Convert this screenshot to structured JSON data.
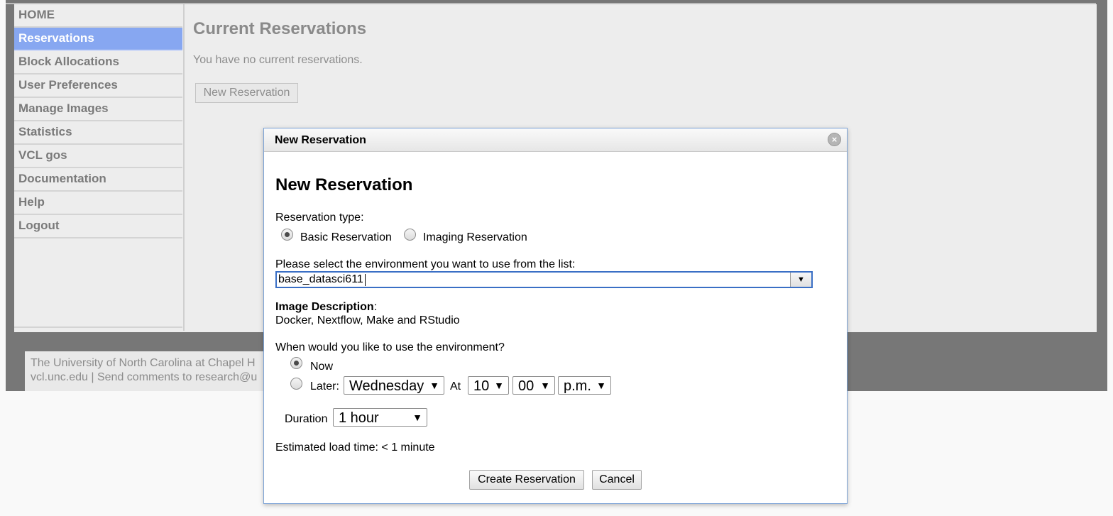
{
  "sidebar": {
    "items": [
      {
        "label": "HOME",
        "active": false
      },
      {
        "label": "Reservations",
        "active": true
      },
      {
        "label": "Block Allocations",
        "active": false
      },
      {
        "label": "User Preferences",
        "active": false
      },
      {
        "label": "Manage Images",
        "active": false
      },
      {
        "label": "Statistics",
        "active": false
      },
      {
        "label": "VCL gos",
        "active": false
      },
      {
        "label": "Documentation",
        "active": false
      },
      {
        "label": "Help",
        "active": false
      },
      {
        "label": "Logout",
        "active": false
      }
    ]
  },
  "main": {
    "title": "Current Reservations",
    "message": "You have no current reservations.",
    "new_button": "New Reservation"
  },
  "footer": {
    "line1": "The University of North Carolina at Chapel H",
    "line2_link": "vcl.unc.edu",
    "line2_text": " | Send comments to research@u"
  },
  "dialog": {
    "titlebar": "New Reservation",
    "close_symbol": "×",
    "heading": "New Reservation",
    "type_label": "Reservation type:",
    "type_options": [
      {
        "label": "Basic Reservation",
        "checked": true
      },
      {
        "label": "Imaging Reservation",
        "checked": false
      }
    ],
    "env_label": "Please select the environment you want to use from the list:",
    "env_value": "base_datasci611",
    "desc_label": "Image Description",
    "desc_colon": ":",
    "desc_text": "Docker, Nextflow, Make and RStudio",
    "when_label": "When would you like to use the environment?",
    "when_now": "Now",
    "when_later": "Later:",
    "day_value": "Wednesday",
    "at_label": "At",
    "hour_value": "10",
    "minute_value": "00",
    "ampm_value": "p.m.",
    "duration_label": "Duration",
    "duration_value": "1 hour",
    "estimate": "Estimated load time: < 1 minute",
    "create_button": "Create Reservation",
    "cancel_button": "Cancel"
  },
  "colors": {
    "overlay": "#777777",
    "active_nav": "#87a7f1",
    "dialog_border": "#7ca3d6",
    "combo_focus": "#3a6fc5"
  },
  "icons": {
    "close": "close-icon",
    "dropdown": "chevron-down-icon"
  }
}
